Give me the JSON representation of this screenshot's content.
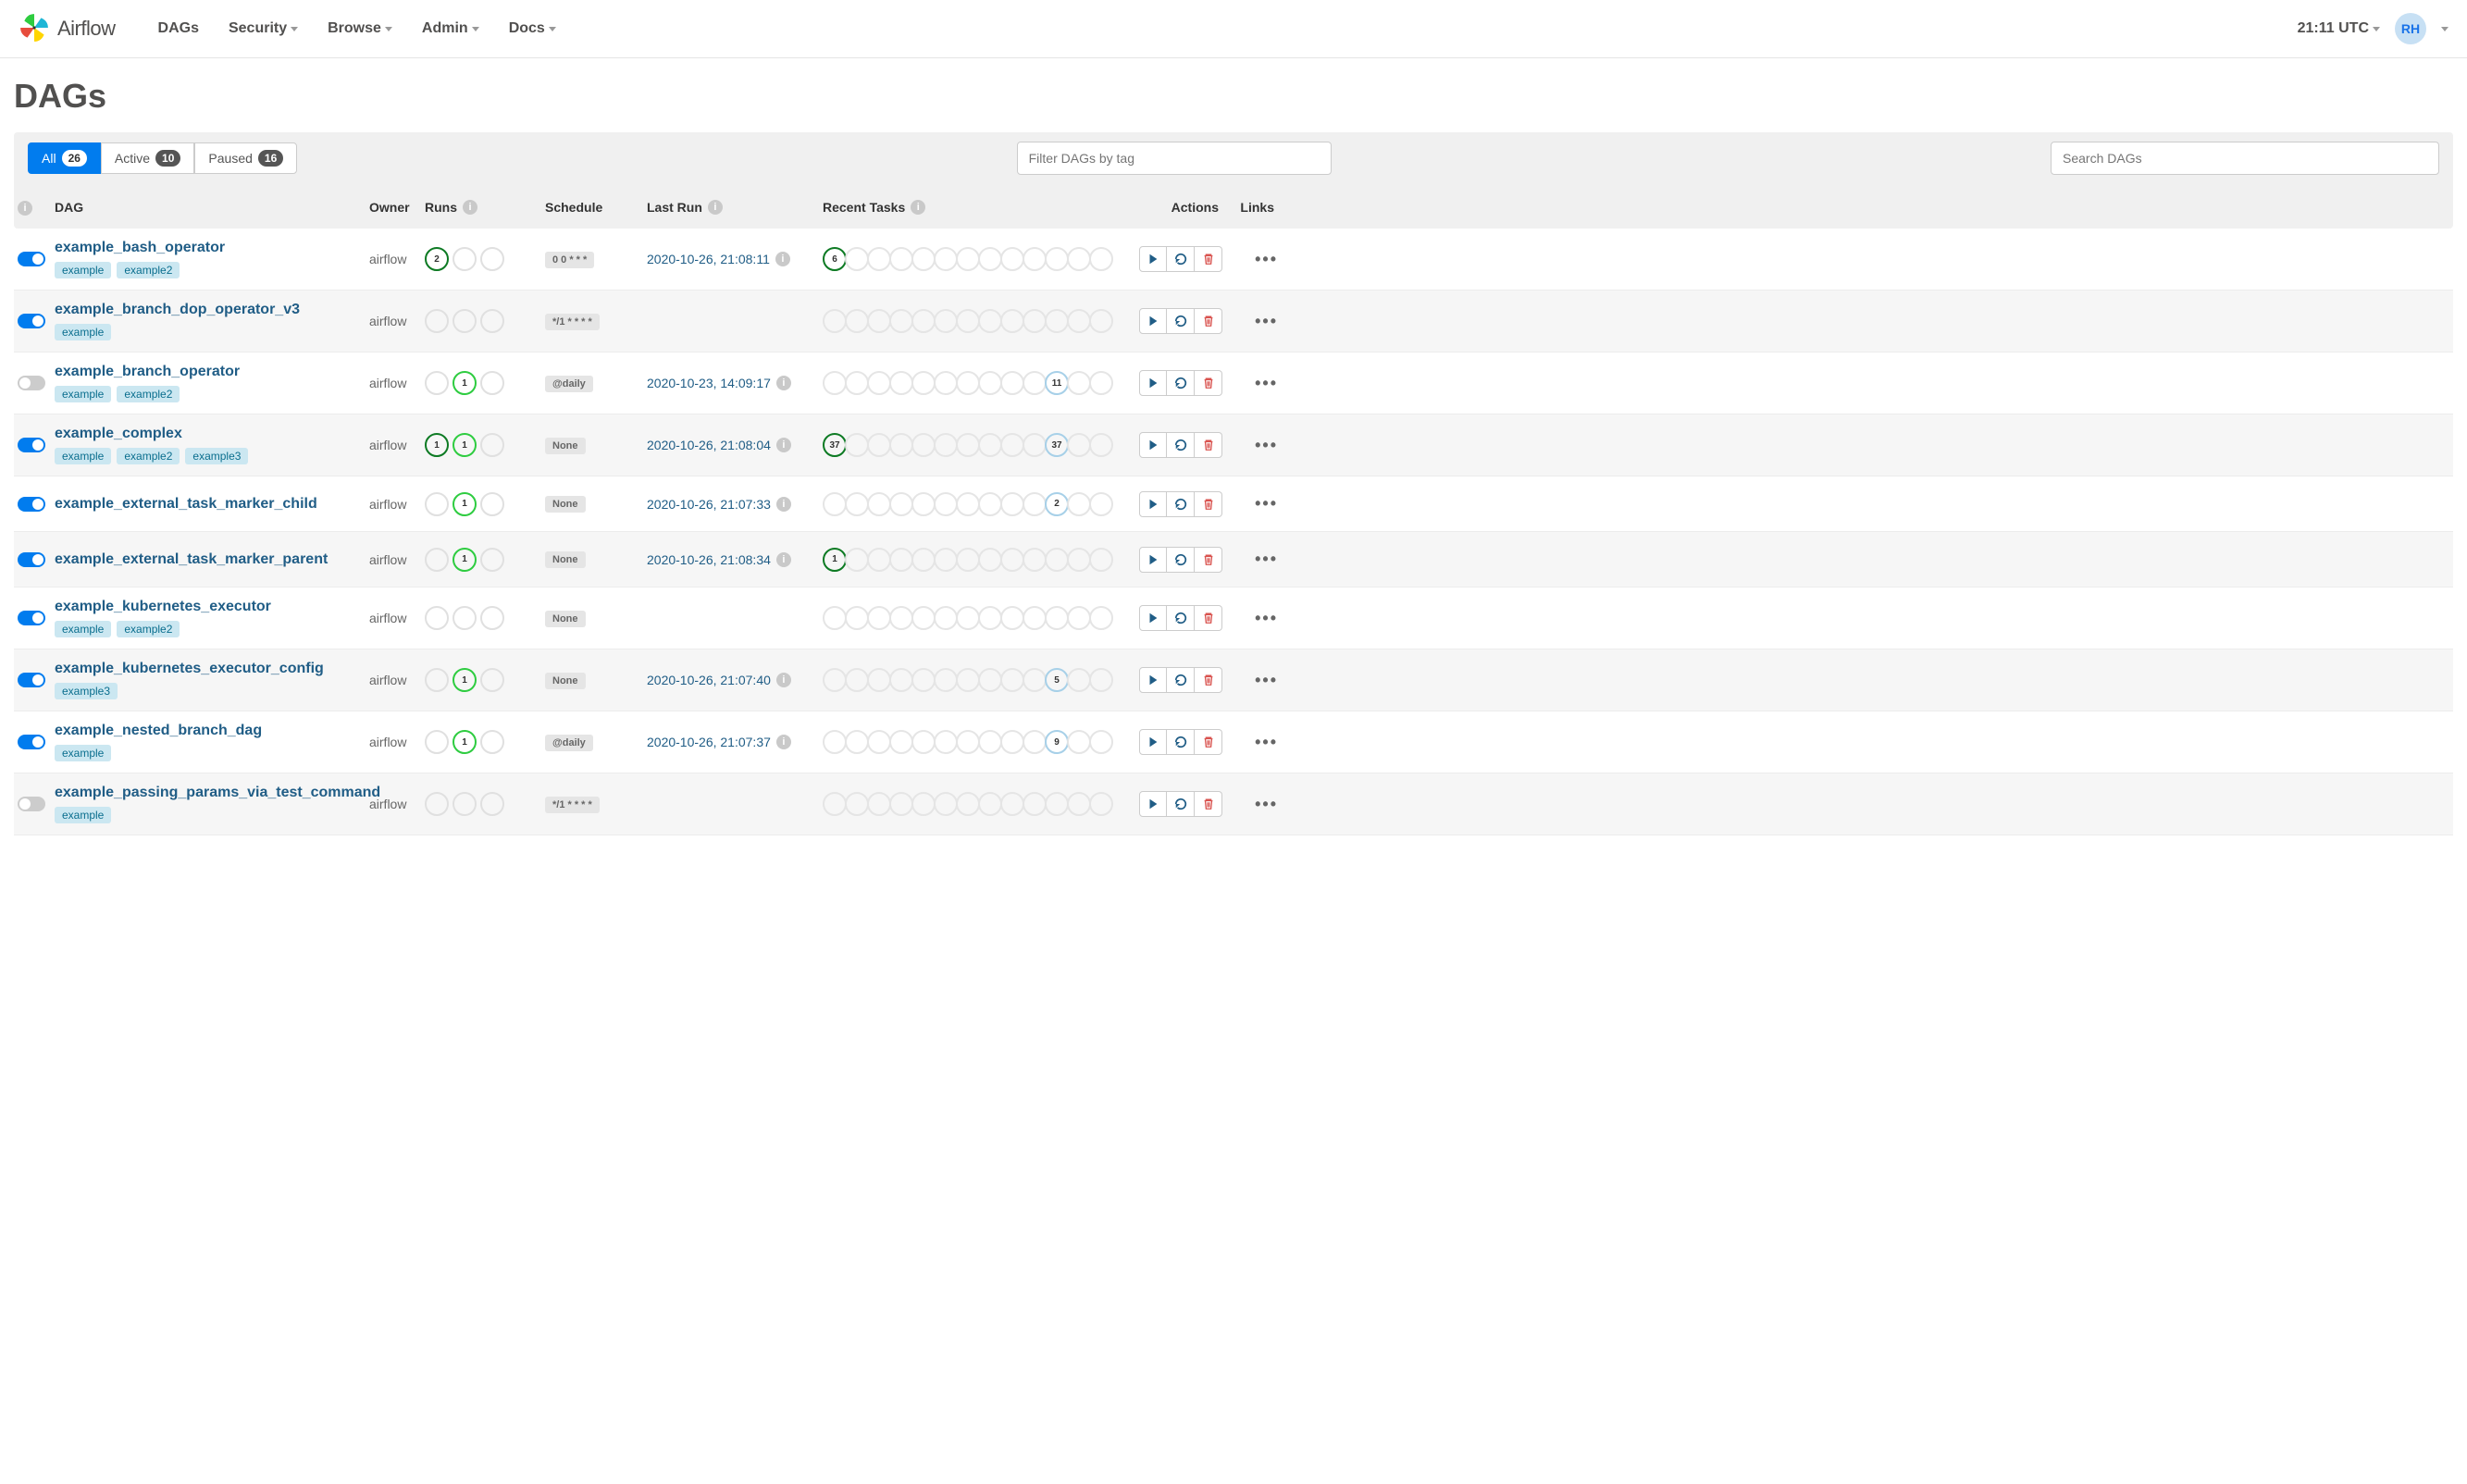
{
  "nav": {
    "brand": "Airflow",
    "links": [
      "DAGs",
      "Security",
      "Browse",
      "Admin",
      "Docs"
    ],
    "time": "21:11 UTC",
    "avatar": "RH"
  },
  "page_title": "DAGs",
  "tabs": {
    "all_label": "All",
    "all_count": "26",
    "active_label": "Active",
    "active_count": "10",
    "paused_label": "Paused",
    "paused_count": "16"
  },
  "filter_placeholder": "Filter DAGs by tag",
  "search_placeholder": "Search DAGs",
  "columns": {
    "dag": "DAG",
    "owner": "Owner",
    "runs": "Runs",
    "schedule": "Schedule",
    "last_run": "Last Run",
    "recent": "Recent Tasks",
    "actions": "Actions",
    "links": "Links"
  },
  "dags": [
    {
      "on": true,
      "name": "example_bash_operator",
      "tags": [
        "example",
        "example2"
      ],
      "owner": "airflow",
      "runs": [
        {
          "n": "2",
          "c": "dark-green"
        },
        {
          "n": "",
          "c": ""
        },
        {
          "n": "",
          "c": ""
        }
      ],
      "schedule": "0 0 * * *",
      "last_run": "2020-10-26, 21:08:11",
      "task6": {
        "n": "6",
        "c": "dark-green"
      },
      "task11": null
    },
    {
      "on": true,
      "name": "example_branch_dop_operator_v3",
      "tags": [
        "example"
      ],
      "owner": "airflow",
      "runs": [
        {
          "n": "",
          "c": ""
        },
        {
          "n": "",
          "c": ""
        },
        {
          "n": "",
          "c": ""
        }
      ],
      "schedule": "*/1 * * * *",
      "last_run": "",
      "task6": null,
      "task11": null
    },
    {
      "on": false,
      "name": "example_branch_operator",
      "tags": [
        "example",
        "example2"
      ],
      "owner": "airflow",
      "runs": [
        {
          "n": "",
          "c": ""
        },
        {
          "n": "1",
          "c": "light-green"
        },
        {
          "n": "",
          "c": ""
        }
      ],
      "schedule": "@daily",
      "last_run": "2020-10-23, 14:09:17",
      "task6": null,
      "task11": {
        "n": "11",
        "c": "light-blue"
      }
    },
    {
      "on": true,
      "name": "example_complex",
      "tags": [
        "example",
        "example2",
        "example3"
      ],
      "owner": "airflow",
      "runs": [
        {
          "n": "1",
          "c": "dark-green"
        },
        {
          "n": "1",
          "c": "light-green"
        },
        {
          "n": "",
          "c": ""
        }
      ],
      "schedule": "None",
      "last_run": "2020-10-26, 21:08:04",
      "task6": {
        "n": "37",
        "c": "dark-green"
      },
      "task11": {
        "n": "37",
        "c": "light-blue"
      }
    },
    {
      "on": true,
      "name": "example_external_task_marker_child",
      "tags": [],
      "owner": "airflow",
      "runs": [
        {
          "n": "",
          "c": ""
        },
        {
          "n": "1",
          "c": "light-green"
        },
        {
          "n": "",
          "c": ""
        }
      ],
      "schedule": "None",
      "last_run": "2020-10-26, 21:07:33",
      "task6": null,
      "task11": {
        "n": "2",
        "c": "light-blue"
      }
    },
    {
      "on": true,
      "name": "example_external_task_marker_parent",
      "tags": [],
      "owner": "airflow",
      "runs": [
        {
          "n": "",
          "c": ""
        },
        {
          "n": "1",
          "c": "light-green"
        },
        {
          "n": "",
          "c": ""
        }
      ],
      "schedule": "None",
      "last_run": "2020-10-26, 21:08:34",
      "task6": {
        "n": "1",
        "c": "dark-green"
      },
      "task11": null
    },
    {
      "on": true,
      "name": "example_kubernetes_executor",
      "tags": [
        "example",
        "example2"
      ],
      "owner": "airflow",
      "runs": [
        {
          "n": "",
          "c": ""
        },
        {
          "n": "",
          "c": ""
        },
        {
          "n": "",
          "c": ""
        }
      ],
      "schedule": "None",
      "last_run": "",
      "task6": null,
      "task11": null
    },
    {
      "on": true,
      "name": "example_kubernetes_executor_config",
      "tags": [
        "example3"
      ],
      "owner": "airflow",
      "runs": [
        {
          "n": "",
          "c": ""
        },
        {
          "n": "1",
          "c": "light-green"
        },
        {
          "n": "",
          "c": ""
        }
      ],
      "schedule": "None",
      "last_run": "2020-10-26, 21:07:40",
      "task6": null,
      "task11": {
        "n": "5",
        "c": "light-blue"
      }
    },
    {
      "on": true,
      "name": "example_nested_branch_dag",
      "tags": [
        "example"
      ],
      "owner": "airflow",
      "runs": [
        {
          "n": "",
          "c": ""
        },
        {
          "n": "1",
          "c": "light-green"
        },
        {
          "n": "",
          "c": ""
        }
      ],
      "schedule": "@daily",
      "last_run": "2020-10-26, 21:07:37",
      "task6": null,
      "task11": {
        "n": "9",
        "c": "light-blue"
      }
    },
    {
      "on": false,
      "name": "example_passing_params_via_test_command",
      "tags": [
        "example"
      ],
      "owner": "airflow",
      "runs": [
        {
          "n": "",
          "c": ""
        },
        {
          "n": "",
          "c": ""
        },
        {
          "n": "",
          "c": ""
        }
      ],
      "schedule": "*/1 * * * *",
      "last_run": "",
      "task6": null,
      "task11": null
    }
  ]
}
